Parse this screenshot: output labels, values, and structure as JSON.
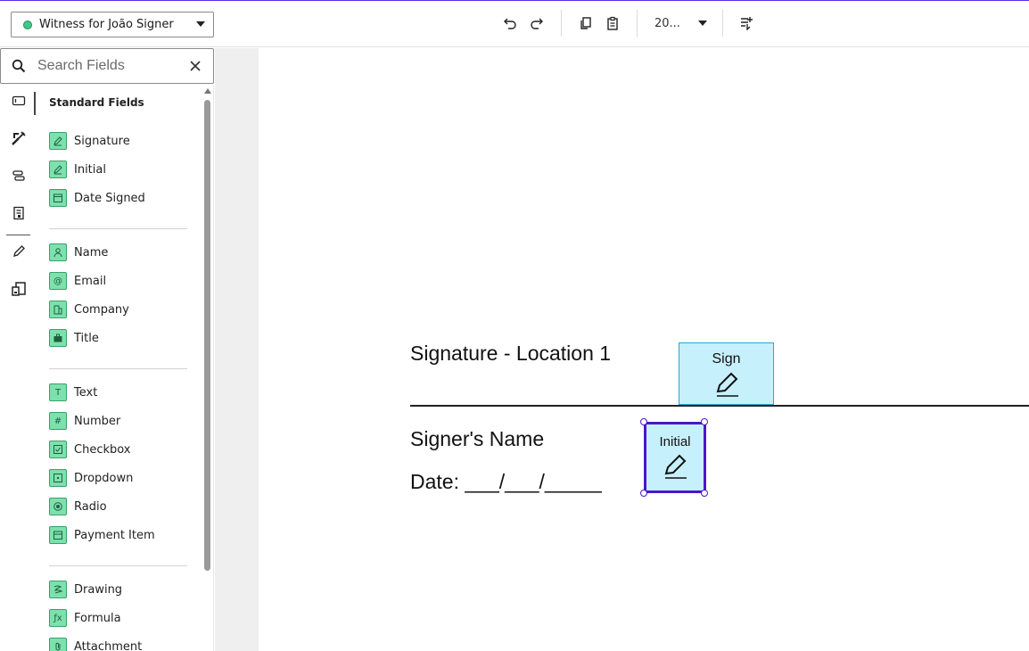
{
  "toolbar": {
    "recipient": {
      "label": "Witness for João Signer",
      "status_color": "#40c88a"
    },
    "zoom_value": "20...",
    "icons": [
      "undo-icon",
      "redo-icon",
      "copy-icon",
      "paste-icon",
      "zoom-caret-icon",
      "add-comment-icon"
    ]
  },
  "search": {
    "placeholder": "Search Fields",
    "value": ""
  },
  "rail": {
    "icons": [
      "field-input-icon",
      "wrench-icon",
      "stack-icon",
      "form-icon",
      "pencil-icon",
      "devices-icon"
    ]
  },
  "panel": {
    "heading": "Standard Fields",
    "groups": [
      {
        "items": [
          {
            "label": "Signature",
            "icon": "pen-icon"
          },
          {
            "label": "Initial",
            "icon": "pen-icon"
          },
          {
            "label": "Date Signed",
            "icon": "calendar-icon"
          }
        ]
      },
      {
        "items": [
          {
            "label": "Name",
            "icon": "person-icon"
          },
          {
            "label": "Email",
            "icon": "at-icon"
          },
          {
            "label": "Company",
            "icon": "building-icon"
          },
          {
            "label": "Title",
            "icon": "briefcase-icon"
          }
        ]
      },
      {
        "items": [
          {
            "label": "Text",
            "icon": "text-icon"
          },
          {
            "label": "Number",
            "icon": "hash-icon"
          },
          {
            "label": "Checkbox",
            "icon": "checkbox-icon"
          },
          {
            "label": "Dropdown",
            "icon": "dropdown-icon"
          },
          {
            "label": "Radio",
            "icon": "radio-icon"
          },
          {
            "label": "Payment Item",
            "icon": "payment-icon"
          }
        ]
      },
      {
        "items": [
          {
            "label": "Drawing",
            "icon": "drawing-icon"
          },
          {
            "label": "Formula",
            "icon": "formula-icon"
          },
          {
            "label": "Attachment",
            "icon": "paperclip-icon"
          }
        ]
      }
    ]
  },
  "document": {
    "signature_heading": "Signature - Location 1",
    "signer_name": "Signer's Name",
    "date_line": "Date: ___/___/_____",
    "tags": {
      "sign": "Sign",
      "initial": "Initial"
    }
  },
  "colors": {
    "accent": "#4b17c8",
    "field_green": "#7ee0ad",
    "tag_fill": "#c6f0fb",
    "tag_border": "#29a8d6"
  }
}
